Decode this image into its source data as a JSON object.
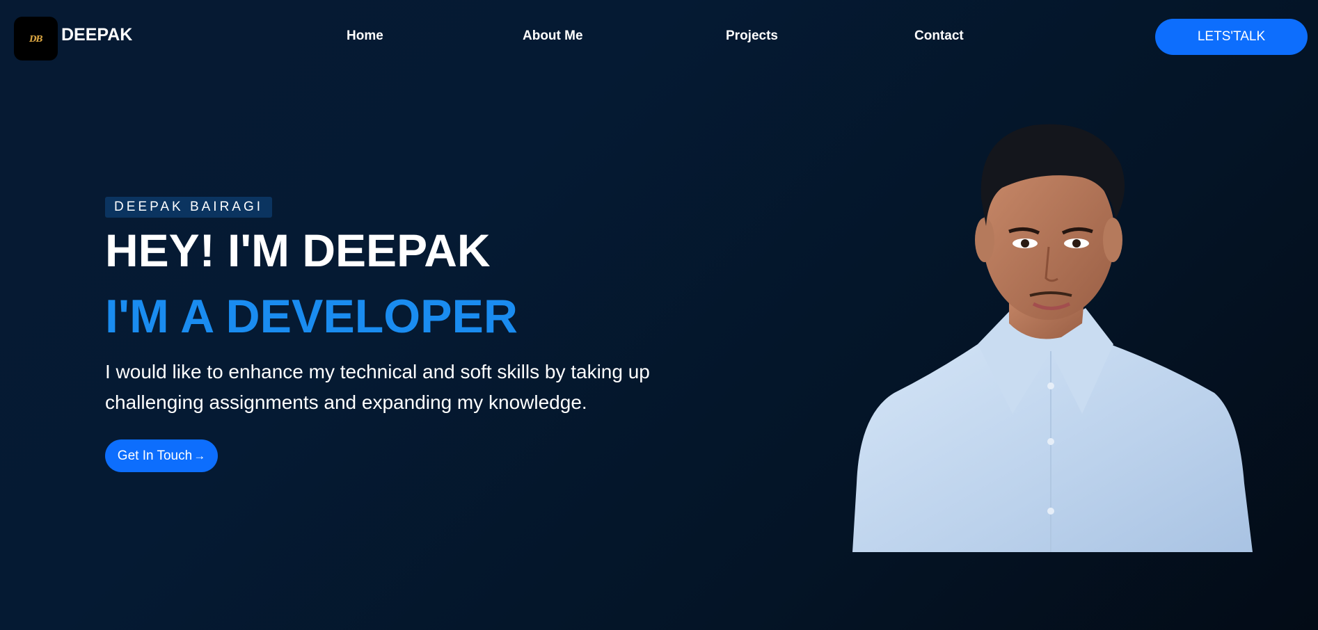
{
  "brand": {
    "logo_text": "DB",
    "name": "DEEPAK"
  },
  "nav": {
    "items": [
      {
        "label": "Home"
      },
      {
        "label": "About Me"
      },
      {
        "label": "Projects"
      },
      {
        "label": "Contact"
      }
    ],
    "cta_label": "LETS'TALK"
  },
  "hero": {
    "tagline": "DEEPAK BAIRAGI",
    "headline": "HEY! I'M DEEPAK",
    "subheadline": "I'M A DEVELOPER",
    "description": "I would like to enhance my technical and soft skills by taking up challenging assignments and expanding my knowledge.",
    "button_label": "Get In Touch",
    "button_icon": "arrow-right-icon",
    "image": "portrait-photo"
  },
  "colors": {
    "background": "#051a33",
    "accent": "#0d6efd",
    "subheadline": "#1a8cf0",
    "tagline_bg": "#0b3460"
  }
}
